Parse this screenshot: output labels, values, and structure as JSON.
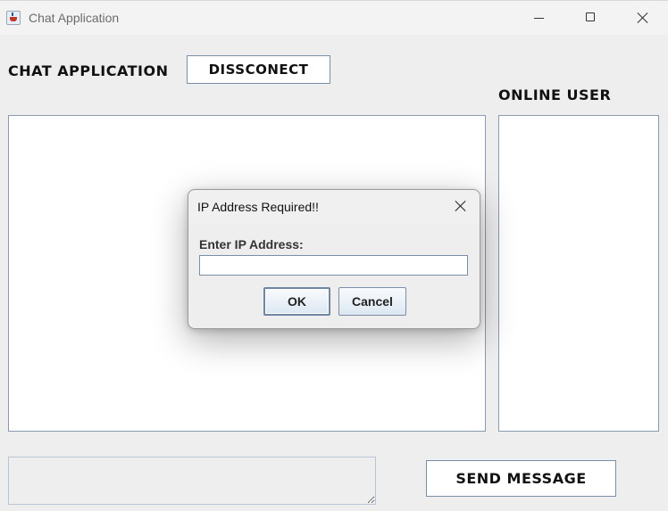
{
  "window": {
    "title": "Chat Application"
  },
  "header": {
    "app_title": "CHAT APPLICATION",
    "disconnect_label": "DISSCONECT"
  },
  "sidebar": {
    "title": "ONLINE USER"
  },
  "footer": {
    "send_label": "SEND MESSAGE",
    "message_value": ""
  },
  "dialog": {
    "title": "IP Address Required!!",
    "field_label": "Enter IP Address:",
    "field_value": "",
    "ok_label": "OK",
    "cancel_label": "Cancel"
  },
  "icons": {
    "app": "java-cup-icon",
    "minimize": "minimize-icon",
    "maximize": "maximize-icon",
    "close": "close-icon",
    "dialog_close": "close-icon"
  }
}
